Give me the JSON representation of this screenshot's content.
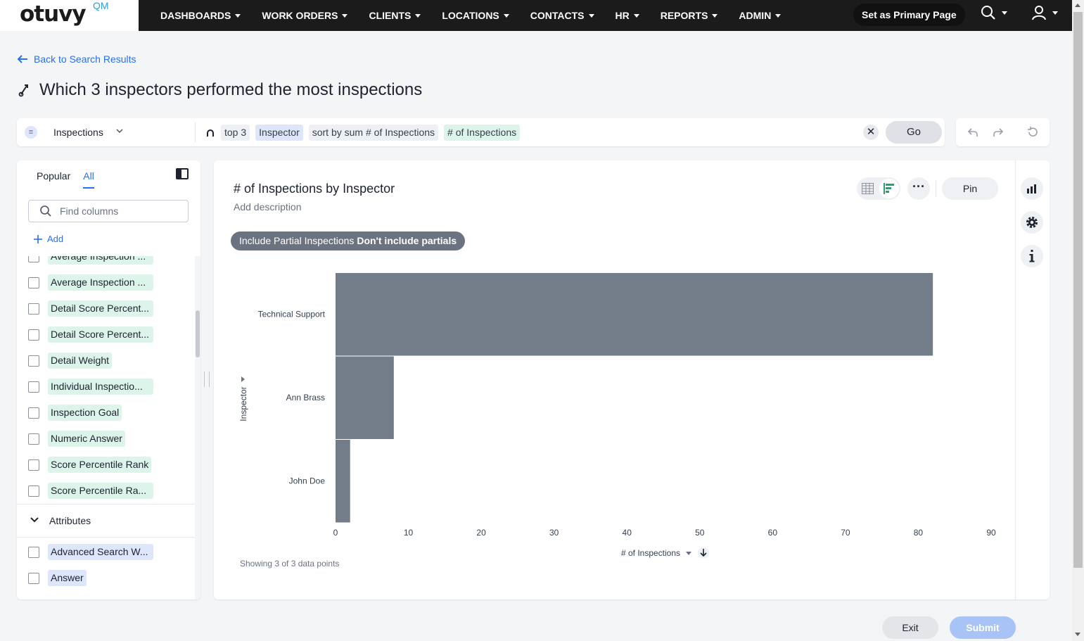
{
  "brand": {
    "logo_text": "otuvy",
    "logo_suffix": "QM"
  },
  "nav": {
    "items": [
      {
        "label": "DASHBOARDS"
      },
      {
        "label": "WORK ORDERS"
      },
      {
        "label": "CLIENTS"
      },
      {
        "label": "LOCATIONS"
      },
      {
        "label": "CONTACTS"
      },
      {
        "label": "HR"
      },
      {
        "label": "REPORTS"
      },
      {
        "label": "ADMIN"
      }
    ],
    "primary_page_label": "Set as Primary Page"
  },
  "page": {
    "back_label": "Back to Search Results",
    "title": "Which 3 inspectors performed the most inspections"
  },
  "search": {
    "source": "Inspections",
    "tokens": [
      {
        "text": "top 3",
        "kind": "keyword"
      },
      {
        "text": "Inspector",
        "kind": "attribute"
      },
      {
        "text": "sort by sum # of Inspections",
        "kind": "keyword"
      },
      {
        "text": "# of Inspections",
        "kind": "measure"
      }
    ],
    "clear_label": "✕",
    "go_label": "Go"
  },
  "left_panel": {
    "tabs": [
      {
        "label": "Popular",
        "active": false
      },
      {
        "label": "All",
        "active": true
      }
    ],
    "find_placeholder": "Find columns",
    "add_label": "Add",
    "columns": [
      {
        "label": "Average Inspection ...",
        "kind": "measure"
      },
      {
        "label": "Average Inspection ...",
        "kind": "measure"
      },
      {
        "label": "Detail Score Percent...",
        "kind": "measure"
      },
      {
        "label": "Detail Score Percent...",
        "kind": "measure"
      },
      {
        "label": "Detail Weight",
        "kind": "measure"
      },
      {
        "label": "Individual Inspectio...",
        "kind": "measure"
      },
      {
        "label": "Inspection Goal",
        "kind": "measure"
      },
      {
        "label": "Numeric Answer",
        "kind": "measure"
      },
      {
        "label": "Score Percentile Rank",
        "kind": "measure"
      },
      {
        "label": "Score Percentile Ra...",
        "kind": "measure"
      }
    ],
    "attributes_header": "Attributes",
    "attributes": [
      {
        "label": "Advanced Search W...",
        "kind": "attribute"
      },
      {
        "label": "Answer",
        "kind": "attribute"
      }
    ]
  },
  "chart_card": {
    "title": "# of Inspections by Inspector",
    "description": "Add description",
    "pin_label": "Pin",
    "more_label": "···",
    "filter_label": "Include Partial Inspections",
    "filter_value": "Don't include partials",
    "data_points_label": "Showing 3 of 3 data points"
  },
  "chart_data": {
    "type": "bar",
    "orientation": "horizontal",
    "categories": [
      "Technical Support",
      "Ann Brass",
      "John Doe"
    ],
    "values": [
      82,
      8,
      2
    ],
    "xlabel": "# of Inspections",
    "ylabel": "Inspector",
    "xlim": [
      0,
      90
    ],
    "xticks": [
      0,
      10,
      20,
      30,
      40,
      50,
      60,
      70,
      80,
      90
    ],
    "bar_color": "#737d8a",
    "grid": false
  },
  "footer": {
    "exit_label": "Exit",
    "submit_label": "Submit"
  },
  "colors": {
    "accent": "#2770ef",
    "topbar": "#1b1b1b",
    "bar": "#737d8a"
  }
}
